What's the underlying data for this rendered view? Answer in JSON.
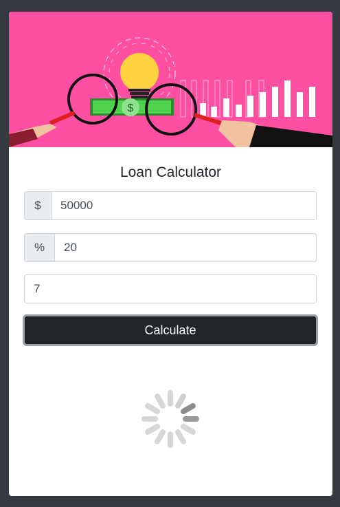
{
  "form": {
    "title": "Loan Calculator",
    "amount": {
      "prefix": "$",
      "value": "50000"
    },
    "interest": {
      "prefix": "%",
      "value": "20"
    },
    "years": {
      "value": "7"
    },
    "calculate_label": "Calculate"
  },
  "colors": {
    "page_bg": "#343a40",
    "banner_bg": "#ff4fa3",
    "button_bg": "#212529"
  },
  "icons": [
    "banner-illustration",
    "loading-spinner-icon"
  ]
}
